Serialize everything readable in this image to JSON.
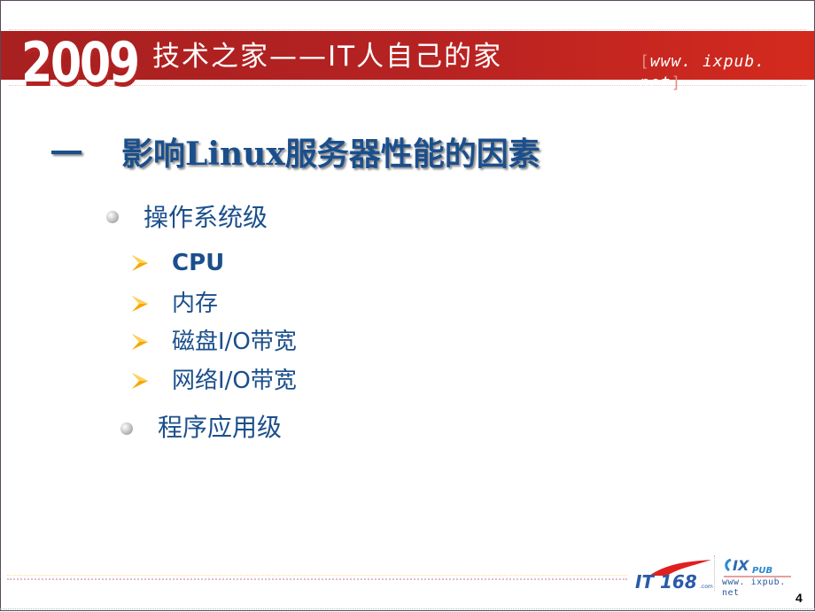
{
  "header": {
    "year": "2009",
    "slogan": "技术之家——IT人自己的家",
    "url_open_bracket": "[",
    "url": "www. ixpub. net",
    "url_close_bracket": "]"
  },
  "slide": {
    "title_number": "一",
    "title": "影响Linux服务器性能的因素",
    "bullets": [
      {
        "label": "操作系统级",
        "sub_items": [
          {
            "label": "CPU"
          },
          {
            "label": "内存"
          },
          {
            "label": "磁盘I/O带宽"
          },
          {
            "label": "网络I/O带宽"
          }
        ]
      },
      {
        "label": "程序应用级"
      }
    ]
  },
  "footer": {
    "logo_left": "IT168",
    "logo_left_suffix": ".com",
    "logo_right": "IXPUB",
    "logo_right_url": "www. ixpub. net",
    "page_number": "4"
  },
  "colors": {
    "banner_red": "#b52222",
    "title_blue": "#1b4f8c",
    "arrow_orange": "#f5a800"
  }
}
